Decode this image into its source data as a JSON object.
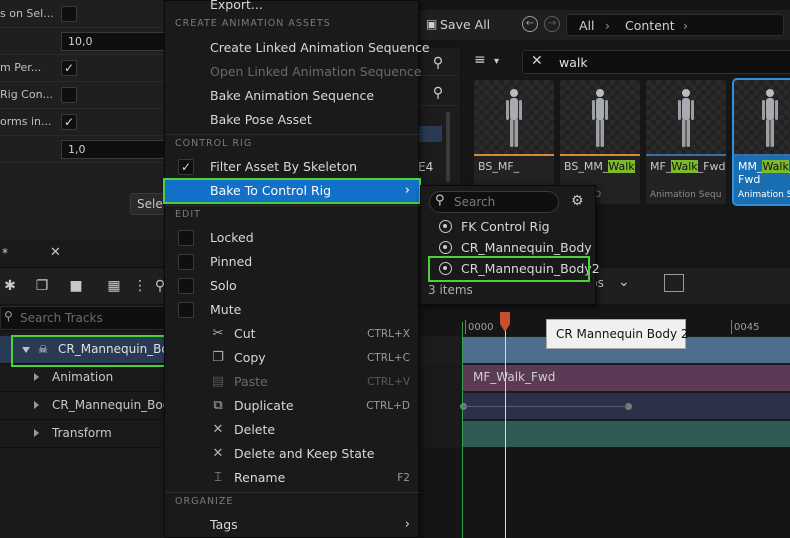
{
  "details": {
    "rows": [
      {
        "label": "s on Sel...",
        "type": "checkbox",
        "checked": false
      },
      {
        "label": "",
        "type": "number",
        "value": "10,0"
      },
      {
        "label": "m Per...",
        "type": "checkbox",
        "checked": true
      },
      {
        "label": "Rig Con...",
        "type": "checkbox",
        "checked": false
      },
      {
        "label": "orms in...",
        "type": "checkbox",
        "checked": true
      },
      {
        "label": "",
        "type": "number",
        "value": "1,0"
      }
    ],
    "select_button": "Sele"
  },
  "sequencer_tab": {
    "title": "*",
    "close": "✕"
  },
  "search_tracks": {
    "placeholder": "Search Tracks"
  },
  "tracks": [
    {
      "name": "CR_Mannequin_Bod",
      "selected": true
    },
    {
      "name": "Animation",
      "selected": false
    },
    {
      "name": "CR_Mannequin_Body",
      "selected": false
    },
    {
      "name": "Transform",
      "selected": false
    }
  ],
  "content_browser": {
    "save_all": "Save All",
    "breadcrumb": [
      "All",
      "Content"
    ],
    "search_value": "walk",
    "sidebar_partial": "E4",
    "assets": [
      {
        "name_pre": "BS_MF_",
        "name_hl": "",
        "name_post": "",
        "line2": "",
        "type": "",
        "bar": "#d68a3c",
        "selected": false
      },
      {
        "name_pre": "BS_MM_",
        "name_hl": "Walk",
        "name_post": "",
        "line2": "",
        "type": "pace 1D",
        "bar": "#d68a3c",
        "selected": false
      },
      {
        "name_pre": "MF_",
        "name_hl": "Walk",
        "name_post": "_Fwd",
        "line2": "",
        "type": "Animation Sequ",
        "bar": "#3a6ea8",
        "selected": false
      },
      {
        "name_pre": "MM_",
        "name_hl": "Walk",
        "name_post": "_",
        "line2": "Fwd",
        "type": "Animation Se",
        "bar": "#3a6ea8",
        "selected": true
      }
    ]
  },
  "sequencer": {
    "playback_label": "ps",
    "ticks": [
      {
        "label": "0000"
      },
      {
        "label": "0045"
      }
    ],
    "section_label": "MF_Walk_Fwd",
    "tooltip": "CR Mannequin Body 2"
  },
  "menu": {
    "top_partial": "Export...",
    "headers": {
      "create": "CREATE ANIMATION ASSETS",
      "control_rig": "CONTROL RIG",
      "edit": "EDIT",
      "organize": "ORGANIZE"
    },
    "create_items": [
      {
        "label": "Create Linked Animation Sequence",
        "disabled": false
      },
      {
        "label": "Open Linked Animation Sequence",
        "disabled": true
      },
      {
        "label": "Bake Animation Sequence",
        "disabled": false
      },
      {
        "label": "Bake Pose Asset",
        "disabled": false
      }
    ],
    "filter_by_skeleton": {
      "label": "Filter Asset By Skeleton",
      "checked": true
    },
    "bake_to_control_rig": "Bake To Control Rig",
    "edit_toggles": [
      {
        "label": "Locked"
      },
      {
        "label": "Pinned"
      },
      {
        "label": "Solo"
      },
      {
        "label": "Mute"
      }
    ],
    "edit_actions": [
      {
        "label": "Cut",
        "shortcut": "CTRL+X",
        "disabled": false,
        "icon": "cut-icon"
      },
      {
        "label": "Copy",
        "shortcut": "CTRL+C",
        "disabled": false,
        "icon": "copy-icon"
      },
      {
        "label": "Paste",
        "shortcut": "CTRL+V",
        "disabled": true,
        "icon": "paste-icon"
      },
      {
        "label": "Duplicate",
        "shortcut": "CTRL+D",
        "disabled": false,
        "icon": "duplicate-icon"
      },
      {
        "label": "Delete",
        "shortcut": "",
        "disabled": false,
        "icon": "delete-icon"
      },
      {
        "label": "Delete and Keep State",
        "shortcut": "",
        "disabled": false,
        "icon": "delete-keep-icon"
      },
      {
        "label": "Rename",
        "shortcut": "F2",
        "disabled": false,
        "icon": "rename-icon"
      }
    ],
    "tags": "Tags"
  },
  "submenu": {
    "search_placeholder": "Search",
    "items": [
      {
        "label": "FK Control Rig"
      },
      {
        "label": "CR_Mannequin_Body"
      },
      {
        "label": "CR_Mannequin_Body2"
      }
    ],
    "count": "3 items"
  },
  "colors": {
    "menu_active": "#1270c8",
    "highlight_outline": "#4cd13a",
    "walk_highlight": "#7dbb2a",
    "selected_asset": "#1a6fb3",
    "playhead": "#c8502e"
  }
}
